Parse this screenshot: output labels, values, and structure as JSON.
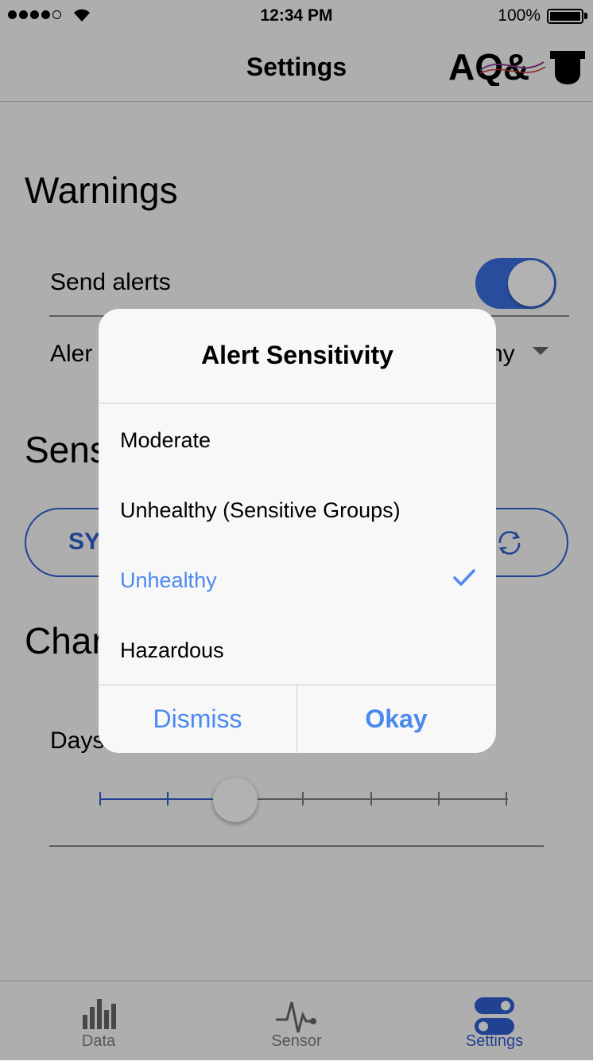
{
  "status_bar": {
    "time": "12:34 PM",
    "battery_percent": "100%",
    "signal_bars_filled": 4,
    "signal_bars_total": 5
  },
  "nav": {
    "title": "Settings",
    "logo_text": "AQ&U"
  },
  "warnings": {
    "title": "Warnings",
    "send_alerts_label": "Send alerts",
    "send_alerts_on": true,
    "alert_level_label_partial": "Aler",
    "alert_level_value_partial": "hy"
  },
  "sensor": {
    "title_partial": "Sens",
    "sync_label_partial": "SY"
  },
  "chart": {
    "title_partial": "Char",
    "days_label_partial": "Days",
    "slider_steps": 7,
    "slider_selected_step": 3
  },
  "tabs": [
    {
      "label": "Data",
      "icon": "bar-chart-icon",
      "active": false
    },
    {
      "label": "Sensor",
      "icon": "pulse-icon",
      "active": false
    },
    {
      "label": "Settings",
      "icon": "toggles-icon",
      "active": true
    }
  ],
  "dialog": {
    "title": "Alert Sensitivity",
    "options": [
      {
        "label": "Moderate",
        "selected": false
      },
      {
        "label": "Unhealthy (Sensitive Groups)",
        "selected": false
      },
      {
        "label": "Unhealthy",
        "selected": true
      },
      {
        "label": "Hazardous",
        "selected": false
      }
    ],
    "dismiss_label": "Dismiss",
    "okay_label": "Okay"
  },
  "colors": {
    "accent": "#2f5fd0",
    "dialog_accent": "#4a89f0",
    "overlay": "rgba(0,0,0,0.30)"
  }
}
